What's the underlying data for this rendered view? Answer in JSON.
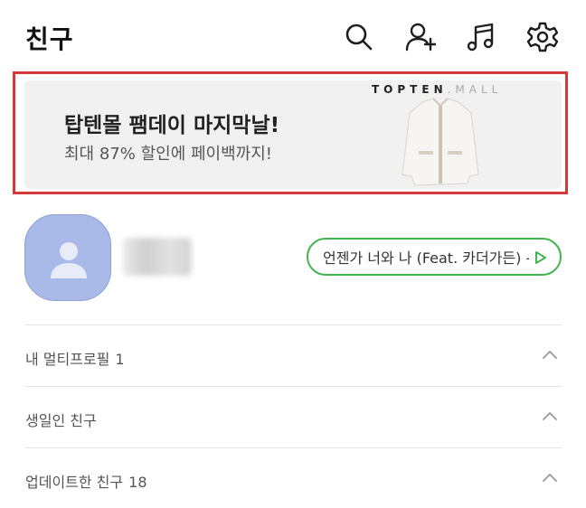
{
  "header": {
    "title": "친구",
    "icons": [
      "search-icon",
      "add-friend-icon",
      "music-icon",
      "settings-icon"
    ]
  },
  "ad": {
    "title": "탑텐몰 팸데이 마지막날!",
    "subtitle": "최대 87% 할인에 페이백까지!",
    "brand": "TOPTEN",
    "brand_suffix": ".MALL"
  },
  "profile": {
    "music": "언젠가 너와 나 (Feat. 카더가든) -..."
  },
  "sections": [
    {
      "label": "내 멀티프로필",
      "count": "1"
    },
    {
      "label": "생일인 친구",
      "count": ""
    },
    {
      "label": "업데이트한 친구",
      "count": "18"
    }
  ],
  "colors": {
    "accent_green": "#3fb650",
    "avatar": "#a9b9e8",
    "highlight_border": "#d23a3a"
  }
}
